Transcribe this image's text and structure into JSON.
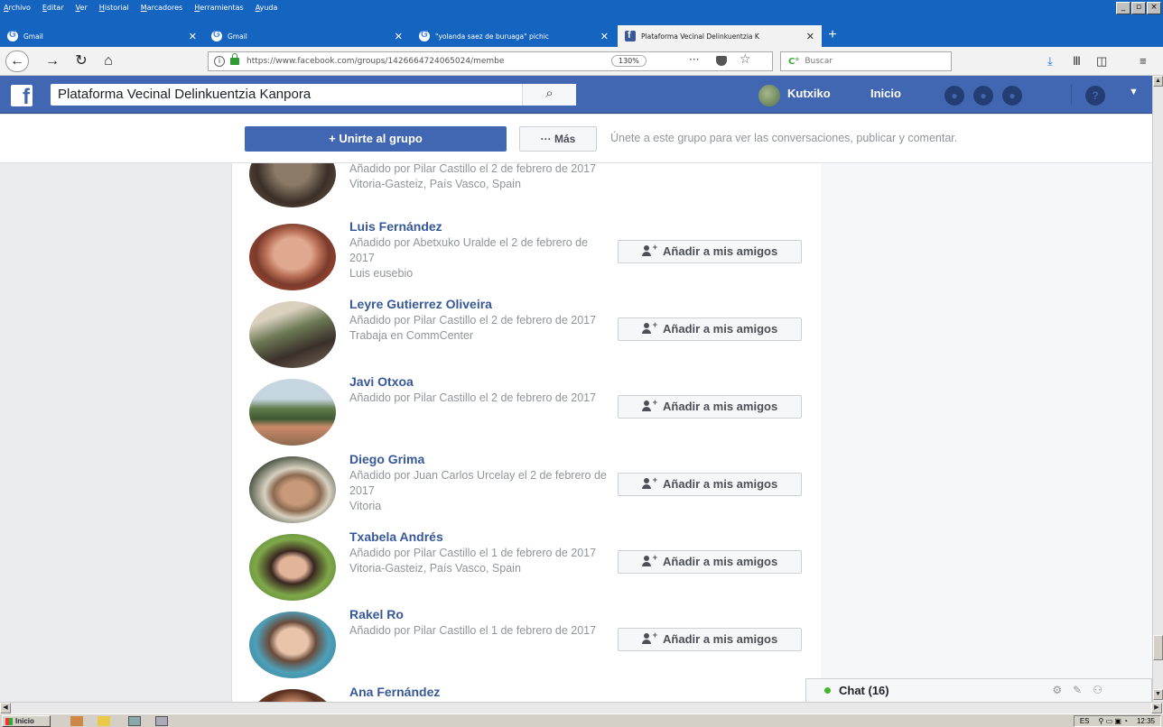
{
  "browser": {
    "menu": [
      "Archivo",
      "Editar",
      "Ver",
      "Historial",
      "Marcadores",
      "Herramientas",
      "Ayuda"
    ],
    "tabs": [
      {
        "title": "Gmail",
        "favicon": "google-icon"
      },
      {
        "title": "Gmail",
        "favicon": "google-icon"
      },
      {
        "title": "\"yolanda saez de buruaga\" pichic",
        "favicon": "google-icon"
      },
      {
        "title": "Plataforma Vecinal Delinkuentzia K",
        "favicon": "facebook-icon",
        "active": true
      }
    ],
    "url": "https://www.facebook.com/groups/1426664724065024/membe",
    "zoom": "130%",
    "search_placeholder": "Buscar"
  },
  "facebook": {
    "search_value": "Plataforma Vecinal Delinkuentzia Kanpora",
    "profile_name": "Kutxiko",
    "home_label": "Inicio",
    "join_button": "+ Unirte al grupo",
    "more_button": "··· Más",
    "join_hint": "Únete a este grupo para ver las conversaciones, publicar y comentar.",
    "add_friend_label": "Añadir a mis amigos",
    "chat_label": "Chat (16)",
    "top_partial": {
      "line1": "Añadido por Pilar Castillo el 2 de febrero de 2017",
      "line2": "Vitoria-Gasteiz, País Vasco, Spain"
    },
    "members": [
      {
        "name": "Luis Fernández",
        "added": "Añadido por Abetxuko Uralde el 2 de febrero de 2017",
        "extra": "Luis eusebio"
      },
      {
        "name": "Leyre Gutierrez Oliveira",
        "added": "Añadido por Pilar Castillo el 2 de febrero de 2017",
        "extra": "Trabaja en CommCenter"
      },
      {
        "name": "Javi Otxoa",
        "added": "Añadido por Pilar Castillo el 2 de febrero de 2017",
        "extra": ""
      },
      {
        "name": "Diego Grima",
        "added": "Añadido por Juan Carlos Urcelay el 2 de febrero de 2017",
        "extra": "Vitoria"
      },
      {
        "name": "Txabela Andrés",
        "added": "Añadido por Pilar Castillo el 1 de febrero de 2017",
        "extra": "Vitoria-Gasteiz, País Vasco, Spain"
      },
      {
        "name": "Rakel Ro",
        "added": "Añadido por Pilar Castillo el 1 de febrero de 2017",
        "extra": ""
      },
      {
        "name": "Ana Fernández",
        "added": "",
        "extra": ""
      }
    ]
  },
  "taskbar": {
    "start_label": "Inicio",
    "lang": "ES",
    "time": "12:35"
  },
  "colors": {
    "firefox_blue": "#1565c0",
    "facebook_blue": "#4267b2",
    "link_blue": "#365899"
  }
}
